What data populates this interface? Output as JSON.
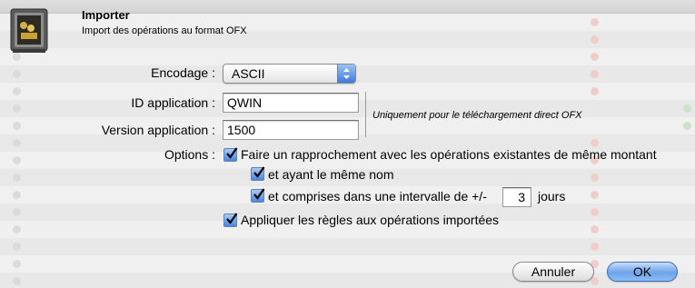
{
  "dialog": {
    "title": "Importer",
    "subtitle": "Import des opérations au format OFX"
  },
  "form": {
    "encoding_label": "Encodage :",
    "encoding_value": "ASCII",
    "app_id_label": "ID application :",
    "app_id_value": "QWIN",
    "app_version_label": "Version application :",
    "app_version_value": "1500",
    "direct_download_note": "Uniquement pour le téléchargement direct OFX"
  },
  "options": {
    "label": "Options :",
    "reconcile": {
      "label": "Faire un rapprochement avec les opérations existantes de même montant",
      "checked": true
    },
    "same_name": {
      "label": "et ayant le même nom",
      "checked": true
    },
    "interval": {
      "label_before": "et comprises dans une intervalle de +/-",
      "days_value": "3",
      "label_after": "jours",
      "checked": true
    },
    "apply_rules": {
      "label": "Appliquer les règles aux opérations importées",
      "checked": true
    }
  },
  "buttons": {
    "cancel": "Annuler",
    "ok": "OK"
  },
  "colors": {
    "accent": "#4a86df",
    "default_button": "#6ea3ea"
  }
}
